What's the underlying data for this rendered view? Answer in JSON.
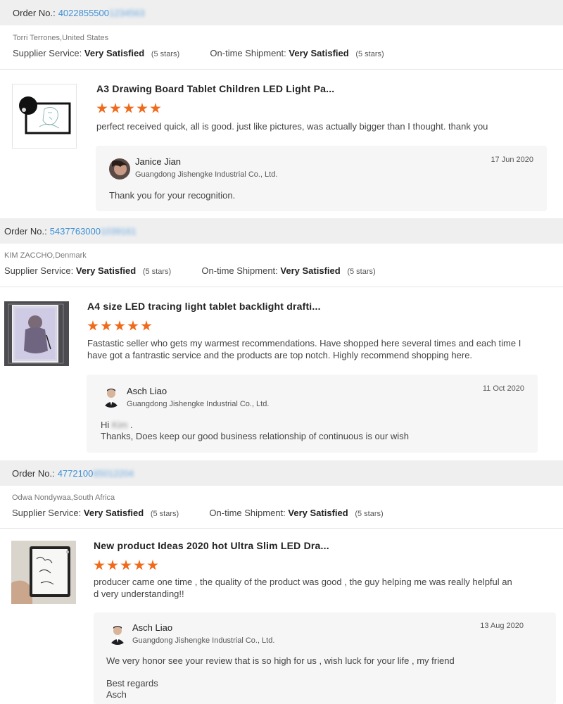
{
  "reviews": [
    {
      "order_label": "Order No.:",
      "order_number": "4022855500",
      "order_number_hidden": "1234563",
      "buyer": "Torri Terrones,United States",
      "supplier_label": "Supplier Service:",
      "supplier_value": "Very Satisfied",
      "supplier_stars": "(5 stars)",
      "shipment_label": "On-time Shipment:",
      "shipment_value": "Very Satisfied",
      "shipment_stars": "(5 stars)",
      "product_title": "A3 Drawing Board Tablet Children LED Light Pa...",
      "rating": 5,
      "review": "perfect received quick, all is good.  just like pictures, was actually bigger than I thought. thank you",
      "reply": {
        "name": "Janice Jian",
        "company": "Guangdong Jishengke Industrial Co., Ltd.",
        "date": "17 Jun 2020",
        "lines": [
          "Thank you for your recognition."
        ]
      }
    },
    {
      "order_label": "Order No.:",
      "order_number": "5437763000",
      "order_number_hidden": "1039161",
      "buyer": "KIM ZACCHO,Denmark",
      "supplier_label": "Supplier Service:",
      "supplier_value": "Very Satisfied",
      "supplier_stars": "(5 stars)",
      "shipment_label": "On-time Shipment:",
      "shipment_value": "Very Satisfied",
      "shipment_stars": "(5 stars)",
      "product_title": "A4 size LED tracing light tablet backlight drafti...",
      "rating": 5,
      "review": "Fastastic seller who gets my warmest recommendations. Have shopped here several times and each time I have got a fantrastic service and the products are top notch. Highly recommend shopping here.",
      "reply": {
        "name": "Asch Liao",
        "company": "Guangdong Jishengke Industrial Co., Ltd.",
        "date": "11 Oct 2020",
        "greeting": "Hi",
        "greeting_hidden": "Kim",
        "lines": [
          "Thanks, Does keep our good business relationship of continuous is our wish"
        ]
      }
    },
    {
      "order_label": "Order No.:",
      "order_number": "4772100",
      "order_number_hidden": "65012204",
      "buyer": "Odwa Nondywaa,South Africa",
      "supplier_label": "Supplier Service:",
      "supplier_value": "Very Satisfied",
      "supplier_stars": "(5 stars)",
      "shipment_label": "On-time Shipment:",
      "shipment_value": "Very Satisfied",
      "shipment_stars": "(5 stars)",
      "product_title": "New product Ideas 2020 hot Ultra Slim LED Dra...",
      "rating": 5,
      "review": "producer came one time , the quality of the product was good , the guy helping me was really helpful and very understanding!!",
      "reply": {
        "name": "Asch Liao",
        "company": "Guangdong Jishengke Industrial Co., Ltd.",
        "date": "13 Aug 2020",
        "lines": [
          "We very honor see your review  that is so high for us , wish luck for your life , my friend",
          "",
          "Best regards",
          "Asch"
        ]
      }
    }
  ],
  "colors": {
    "star": "#f06a1b",
    "order_link": "#3c8fd6",
    "header_bg": "#efefef",
    "reply_bg": "#f6f6f6"
  }
}
